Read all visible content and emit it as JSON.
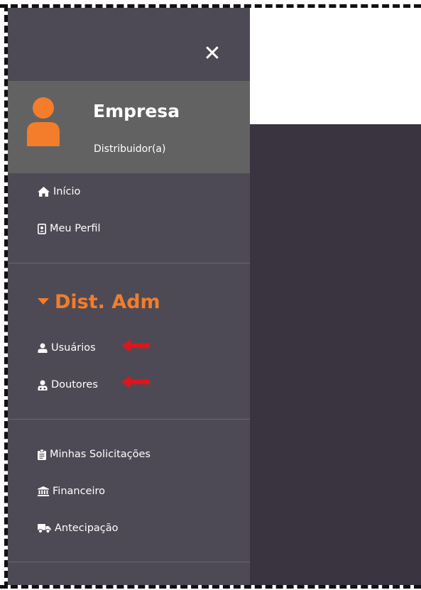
{
  "sidebar": {
    "close_icon": "close-icon",
    "profile": {
      "name": "Empresa",
      "role": "Distribuidor(a)",
      "avatar_icon": "user-icon",
      "avatar_color": "#f37d2b"
    },
    "primary_items": [
      {
        "label": "Início",
        "icon": "home-icon"
      },
      {
        "label": "Meu Perfil",
        "icon": "id-card-icon"
      }
    ],
    "section": {
      "title": "Dist. Adm",
      "icon": "caret-down-icon",
      "color": "#f37d2b",
      "items": [
        {
          "label": "Usuários",
          "icon": "user-icon"
        },
        {
          "label": "Doutores",
          "icon": "user-doctor-icon"
        }
      ]
    },
    "secondary_items": [
      {
        "label": "Minhas Solicitações",
        "icon": "clipboard-icon"
      },
      {
        "label": "Financeiro",
        "icon": "bank-icon"
      },
      {
        "label": "Antecipação",
        "icon": "truck-icon"
      }
    ]
  },
  "annotations": {
    "arrow_color": "#e2141b"
  },
  "colors": {
    "sidebar_bg": "#4e4a55",
    "profile_bg": "#626262",
    "content_bg": "#393440",
    "accent": "#f37d2b"
  }
}
